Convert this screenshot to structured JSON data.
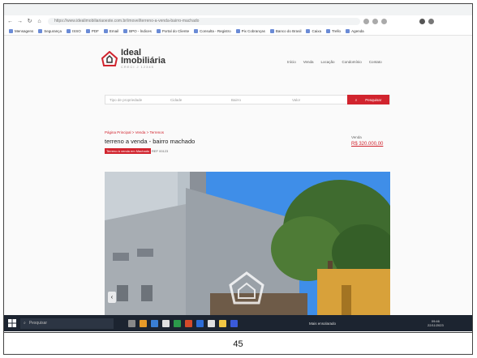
{
  "browser": {
    "url": "https://www.idealimobiliariaoeste.com.br/imovel/terreno-a-venda-bairro-machado",
    "bookmarks": [
      "Mensagens",
      "Segurança",
      "ISSO",
      "PDF",
      "Email",
      "BPO - Índices",
      "Portal do Cliente",
      "Consulta - Registro",
      "Pix Cobranças",
      "Banco do Brasil",
      "Caixa",
      "Trello",
      "Agenda"
    ]
  },
  "site": {
    "brand": "Ideal",
    "brand_line2": "Imobiliária",
    "creci": "CRECI J 12345",
    "nav": [
      "Início",
      "Venda",
      "Locação",
      "Condomínio",
      "Contato"
    ]
  },
  "search": {
    "field1": "Tipo de propriedade",
    "field2": "Cidade",
    "field3": "Bairro",
    "field4": "Valor",
    "button": "Pesquisar"
  },
  "listing": {
    "breadcrumb": "Página Principal  >  Venda  >  Terrenos",
    "title": "terreno a venda - bairro machado",
    "badge": "Terreno à venda em Machado",
    "code": "REF 00123",
    "price_label": "Venda",
    "price": "R$ 320.000,00"
  },
  "taskbar": {
    "search_placeholder": "Pesquisar",
    "weather": "Mais ensolarado",
    "clock_time": "09:46",
    "clock_date": "22/11/2023"
  },
  "footer": {
    "page_number": "45"
  },
  "colors": {
    "accent": "#d1242e",
    "taskbar": "#1c2430"
  }
}
